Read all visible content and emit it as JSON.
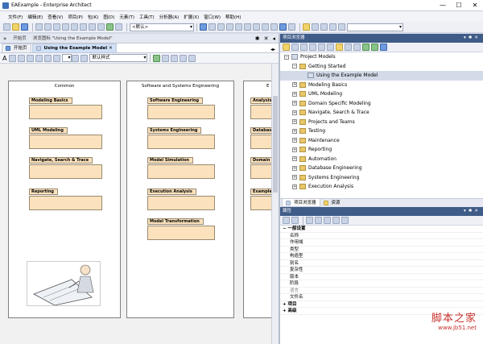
{
  "window": {
    "title": "EAExample - Enterprise Architect",
    "buttons": [
      "—",
      "☐",
      "✕"
    ]
  },
  "menu": [
    "文件(F)",
    "编辑(E)",
    "查看(V)",
    "项目(P)",
    "包(K)",
    "图(D)",
    "元素(T)",
    "工具(T)",
    "分析器(A)",
    "扩展(X)",
    "窗口(W)",
    "帮助(H)"
  ],
  "toolbar": {
    "combo1": "<默认>",
    "combo2": "默认样式"
  },
  "doc_header": {
    "tabs": [
      {
        "label": "开始页"
      },
      {
        "label": "浏览图标 \"Using the Example Model\""
      }
    ],
    "controls": [
      "✱",
      "✕",
      "◂"
    ]
  },
  "diagram_tab": {
    "label": "Using the Example Model",
    "close": "✕",
    "nav": "◂▸"
  },
  "diagram": {
    "lanes": [
      {
        "header": "Common",
        "packages": [
          "Modeling Basics",
          "UML Modeling",
          "Navigate, Search & Trace",
          "Reporting"
        ]
      },
      {
        "header": "Software and Systems Engineering",
        "packages": [
          "Software Engineering",
          "Systems Engineering",
          "Model Simulation",
          "Execution Analysis",
          "Model Transformation"
        ]
      },
      {
        "header": "E",
        "packages": [
          "Analysis",
          "Database",
          "Domain I",
          "Example"
        ]
      }
    ]
  },
  "project_browser": {
    "title": "项目浏览器",
    "tree": [
      {
        "label": "Project Models",
        "level": 0,
        "expander": "−",
        "kind": "model"
      },
      {
        "label": "Getting Started",
        "level": 1,
        "expander": "−",
        "kind": "folder"
      },
      {
        "label": "Using the Example Model",
        "level": 2,
        "expander": "",
        "kind": "diagram",
        "selected": true
      },
      {
        "label": "Modeling Basics",
        "level": 1,
        "expander": "+",
        "kind": "folder"
      },
      {
        "label": "UML Modeling",
        "level": 1,
        "expander": "+",
        "kind": "folder"
      },
      {
        "label": "Domain Specific Modeling",
        "level": 1,
        "expander": "+",
        "kind": "folder"
      },
      {
        "label": "Navigate, Search & Trace",
        "level": 1,
        "expander": "+",
        "kind": "folder"
      },
      {
        "label": "Projects and Teams",
        "level": 1,
        "expander": "+",
        "kind": "folder"
      },
      {
        "label": "Testing",
        "level": 1,
        "expander": "+",
        "kind": "folder"
      },
      {
        "label": "Maintenance",
        "level": 1,
        "expander": "+",
        "kind": "folder"
      },
      {
        "label": "Reporting",
        "level": 1,
        "expander": "+",
        "kind": "folder"
      },
      {
        "label": "Automation",
        "level": 1,
        "expander": "+",
        "kind": "folder"
      },
      {
        "label": "Database Engineering",
        "level": 1,
        "expander": "+",
        "kind": "folder"
      },
      {
        "label": "Systems Engineering",
        "level": 1,
        "expander": "+",
        "kind": "folder"
      },
      {
        "label": "Execution Analysis",
        "level": 1,
        "expander": "+",
        "kind": "folder"
      }
    ],
    "bottom_tabs": [
      "项目浏览器",
      "资源"
    ]
  },
  "properties": {
    "title": "属性",
    "rows": [
      {
        "label": "一般设置",
        "type": "cat",
        "marker": "−"
      },
      {
        "label": "名称",
        "type": "row"
      },
      {
        "label": "作用域",
        "type": "row"
      },
      {
        "label": "类型",
        "type": "row"
      },
      {
        "label": "构造型",
        "type": "row"
      },
      {
        "label": "别名",
        "type": "row"
      },
      {
        "label": "复杂性",
        "type": "row"
      },
      {
        "label": "版本",
        "type": "row"
      },
      {
        "label": "阶段",
        "type": "row"
      },
      {
        "label": "语言",
        "type": "dim"
      },
      {
        "label": "文件名",
        "type": "row"
      },
      {
        "label": "项目",
        "type": "cat",
        "marker": "+"
      },
      {
        "label": "高级",
        "type": "cat",
        "marker": "+"
      }
    ]
  },
  "watermark": {
    "line1": "脚本之家",
    "line2": "www.jb51.net"
  }
}
